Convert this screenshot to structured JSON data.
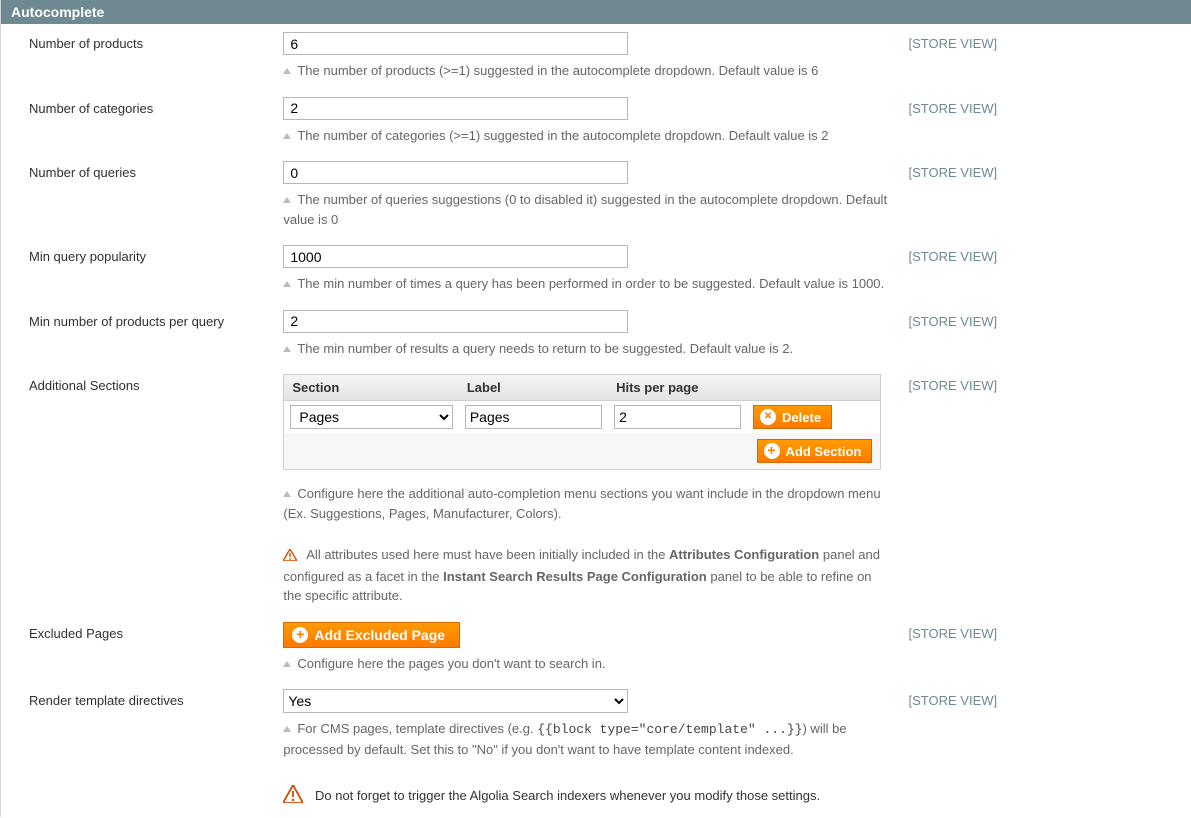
{
  "panel": {
    "title": "Autocomplete"
  },
  "scope_label": "[STORE VIEW]",
  "buttons": {
    "delete": "Delete",
    "add_section": "Add Section",
    "add_excluded": "Add Excluded Page"
  },
  "additional_table": {
    "headers": {
      "section": "Section",
      "label": "Label",
      "hits": "Hits per page"
    },
    "row": {
      "section_selected": "Pages",
      "label_value": "Pages",
      "hits_value": "2"
    }
  },
  "fields": {
    "num_products": {
      "label": "Number of products",
      "value": "6",
      "hint": "The number of products (>=1) suggested in the autocomplete dropdown. Default value is 6"
    },
    "num_categories": {
      "label": "Number of categories",
      "value": "2",
      "hint": "The number of categories (>=1) suggested in the autocomplete dropdown. Default value is 2"
    },
    "num_queries": {
      "label": "Number of queries",
      "value": "0",
      "hint": "The number of queries suggestions (0 to disabled it) suggested in the autocomplete dropdown. Default value is 0"
    },
    "min_popularity": {
      "label": "Min query popularity",
      "value": "1000",
      "hint": "The min number of times a query has been performed in order to be suggested. Default value is 1000."
    },
    "min_products_per_query": {
      "label": "Min number of products per query",
      "value": "2",
      "hint": "The min number of results a query needs to return to be suggested. Default value is 2."
    },
    "additional": {
      "label": "Additional Sections",
      "hint": "Configure here the additional auto-completion menu sections you want include in the dropdown menu (Ex. Suggestions, Pages, Manufacturer, Colors).",
      "warn_pre": "All attributes used here must have been initially included in the ",
      "warn_bold1": "Attributes Configuration",
      "warn_mid": " panel and configured as a facet in the ",
      "warn_bold2": "Instant Search Results Page Configuration",
      "warn_post": " panel to be able to refine on the specific attribute."
    },
    "excluded": {
      "label": "Excluded Pages",
      "hint": "Configure here the pages you don't want to search in."
    },
    "render": {
      "label": "Render template directives",
      "value": "Yes",
      "hint_pre": "For CMS pages, template directives (e.g. ",
      "hint_code": "{{block type=\"core/template\" ...}}",
      "hint_post": ") will be processed by default. Set this to \"No\" if you don't want to have template content indexed.",
      "warn_big": "Do not forget to trigger the Algolia Search indexers whenever you modify those settings."
    }
  }
}
